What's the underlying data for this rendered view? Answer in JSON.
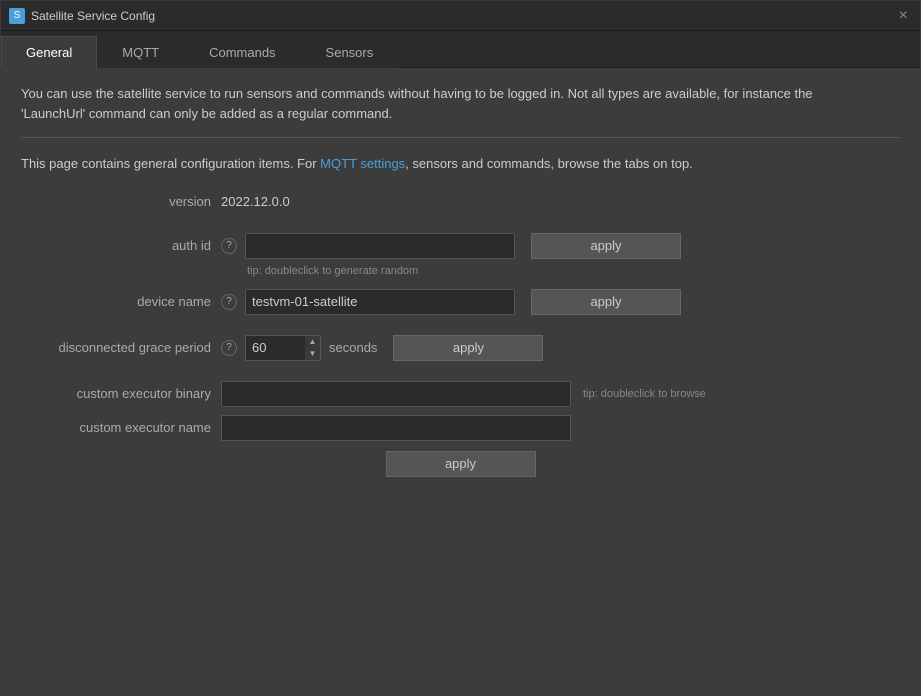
{
  "window": {
    "title": "Satellite Service Config",
    "close_label": "×"
  },
  "app_icon": "S",
  "tabs": [
    {
      "id": "general",
      "label": "General",
      "active": true
    },
    {
      "id": "mqtt",
      "label": "MQTT",
      "active": false
    },
    {
      "id": "commands",
      "label": "Commands",
      "active": false
    },
    {
      "id": "sensors",
      "label": "Sensors",
      "active": false
    }
  ],
  "content": {
    "info_line1": "You can use the satellite service to run sensors and commands without having to be logged in. Not all types are available, for instance the",
    "info_line2": "'LaunchUrl' command can only be added as a regular command.",
    "page_info": "This page contains general configuration items. For MQTT settings, sensors and commands, browse the tabs on top.",
    "version_label": "version",
    "version_value": "2022.12.0.0",
    "auth_id": {
      "label": "auth id",
      "value": "",
      "placeholder": "",
      "tip": "tip: doubleclick to generate random",
      "apply_label": "apply"
    },
    "device_name": {
      "label": "device name",
      "value": "testvm-01-satellite",
      "apply_label": "apply"
    },
    "grace_period": {
      "label": "disconnected grace period",
      "value": "60",
      "seconds_label": "seconds",
      "apply_label": "apply"
    },
    "executor": {
      "binary_label": "custom executor binary",
      "binary_value": "",
      "binary_tip": "tip: doubleclick to browse",
      "name_label": "custom executor name",
      "name_value": "",
      "apply_label": "apply"
    }
  }
}
